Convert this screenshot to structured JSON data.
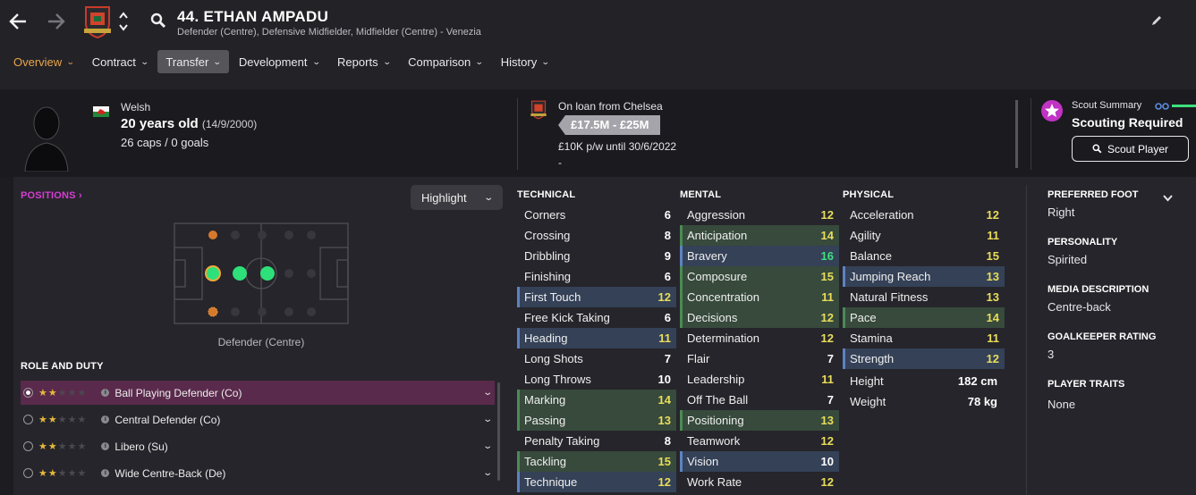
{
  "header": {
    "title": "44. ETHAN AMPADU",
    "subtitle": "Defender (Centre), Defensive Midfielder, Midfielder (Centre) - Venezia"
  },
  "tabs": [
    {
      "label": "Overview"
    },
    {
      "label": "Contract"
    },
    {
      "label": "Transfer"
    },
    {
      "label": "Development"
    },
    {
      "label": "Reports"
    },
    {
      "label": "Comparison"
    },
    {
      "label": "History"
    }
  ],
  "info": {
    "nationality": "Welsh",
    "age": "20 years old",
    "dob": "(14/9/2000)",
    "caps": "26 caps / 0 goals",
    "loan": "On loan from Chelsea",
    "value": "£17.5M - £25M",
    "wage": "£10K p/w until 30/6/2022",
    "dash": "-",
    "scout_label": "Scout Summary",
    "scout_status": "Scouting Required",
    "scout_button": "Scout Player"
  },
  "positions": {
    "header": "POSITIONS",
    "highlight": "Highlight",
    "position_label": "Defender (Centre)"
  },
  "roles": {
    "header": "ROLE AND DUTY",
    "items": [
      {
        "label": "Ball Playing Defender (Co)",
        "stars": 2,
        "selected": true
      },
      {
        "label": "Central Defender (Co)",
        "stars": 2,
        "selected": false
      },
      {
        "label": "Libero (Su)",
        "stars": 2,
        "selected": false
      },
      {
        "label": "Wide Centre-Back (De)",
        "stars": 2,
        "selected": false
      }
    ]
  },
  "technical": {
    "header": "TECHNICAL",
    "rows": [
      {
        "name": "Corners",
        "value": "6",
        "hl": ""
      },
      {
        "name": "Crossing",
        "value": "8",
        "hl": ""
      },
      {
        "name": "Dribbling",
        "value": "9",
        "hl": ""
      },
      {
        "name": "Finishing",
        "value": "6",
        "hl": ""
      },
      {
        "name": "First Touch",
        "value": "12",
        "hl": "blue"
      },
      {
        "name": "Free Kick Taking",
        "value": "6",
        "hl": ""
      },
      {
        "name": "Heading",
        "value": "11",
        "hl": "blue"
      },
      {
        "name": "Long Shots",
        "value": "7",
        "hl": ""
      },
      {
        "name": "Long Throws",
        "value": "10",
        "hl": ""
      },
      {
        "name": "Marking",
        "value": "14",
        "hl": "green"
      },
      {
        "name": "Passing",
        "value": "13",
        "hl": "green"
      },
      {
        "name": "Penalty Taking",
        "value": "8",
        "hl": ""
      },
      {
        "name": "Tackling",
        "value": "15",
        "hl": "green"
      },
      {
        "name": "Technique",
        "value": "12",
        "hl": "blue"
      }
    ]
  },
  "mental": {
    "header": "MENTAL",
    "rows": [
      {
        "name": "Aggression",
        "value": "12",
        "hl": ""
      },
      {
        "name": "Anticipation",
        "value": "14",
        "hl": "green"
      },
      {
        "name": "Bravery",
        "value": "16",
        "hl": "blue"
      },
      {
        "name": "Composure",
        "value": "15",
        "hl": "green"
      },
      {
        "name": "Concentration",
        "value": "11",
        "hl": "green"
      },
      {
        "name": "Decisions",
        "value": "12",
        "hl": "green"
      },
      {
        "name": "Determination",
        "value": "12",
        "hl": ""
      },
      {
        "name": "Flair",
        "value": "7",
        "hl": ""
      },
      {
        "name": "Leadership",
        "value": "11",
        "hl": ""
      },
      {
        "name": "Off The Ball",
        "value": "7",
        "hl": ""
      },
      {
        "name": "Positioning",
        "value": "13",
        "hl": "green"
      },
      {
        "name": "Teamwork",
        "value": "12",
        "hl": ""
      },
      {
        "name": "Vision",
        "value": "10",
        "hl": "blue"
      },
      {
        "name": "Work Rate",
        "value": "12",
        "hl": ""
      }
    ]
  },
  "physical": {
    "header": "PHYSICAL",
    "rows": [
      {
        "name": "Acceleration",
        "value": "12",
        "hl": ""
      },
      {
        "name": "Agility",
        "value": "11",
        "hl": ""
      },
      {
        "name": "Balance",
        "value": "15",
        "hl": ""
      },
      {
        "name": "Jumping Reach",
        "value": "13",
        "hl": "blue"
      },
      {
        "name": "Natural Fitness",
        "value": "13",
        "hl": ""
      },
      {
        "name": "Pace",
        "value": "14",
        "hl": "green"
      },
      {
        "name": "Stamina",
        "value": "11",
        "hl": ""
      },
      {
        "name": "Strength",
        "value": "12",
        "hl": "blue"
      }
    ],
    "height_label": "Height",
    "height_value": "182 cm",
    "weight_label": "Weight",
    "weight_value": "78 kg"
  },
  "sidebar": {
    "foot_label": "PREFERRED FOOT",
    "foot_value": "Right",
    "personality_label": "PERSONALITY",
    "personality_value": "Spirited",
    "media_label": "MEDIA DESCRIPTION",
    "media_value": "Centre-back",
    "gk_label": "GOALKEEPER RATING",
    "gk_value": "3",
    "traits_label": "PLAYER TRAITS",
    "traits_value": "None"
  },
  "colors": {
    "accent": "#e8a64a",
    "positions_link": "#d63ed3",
    "attr_high": "#3ee07c",
    "attr_mid": "#e9dd5a"
  }
}
